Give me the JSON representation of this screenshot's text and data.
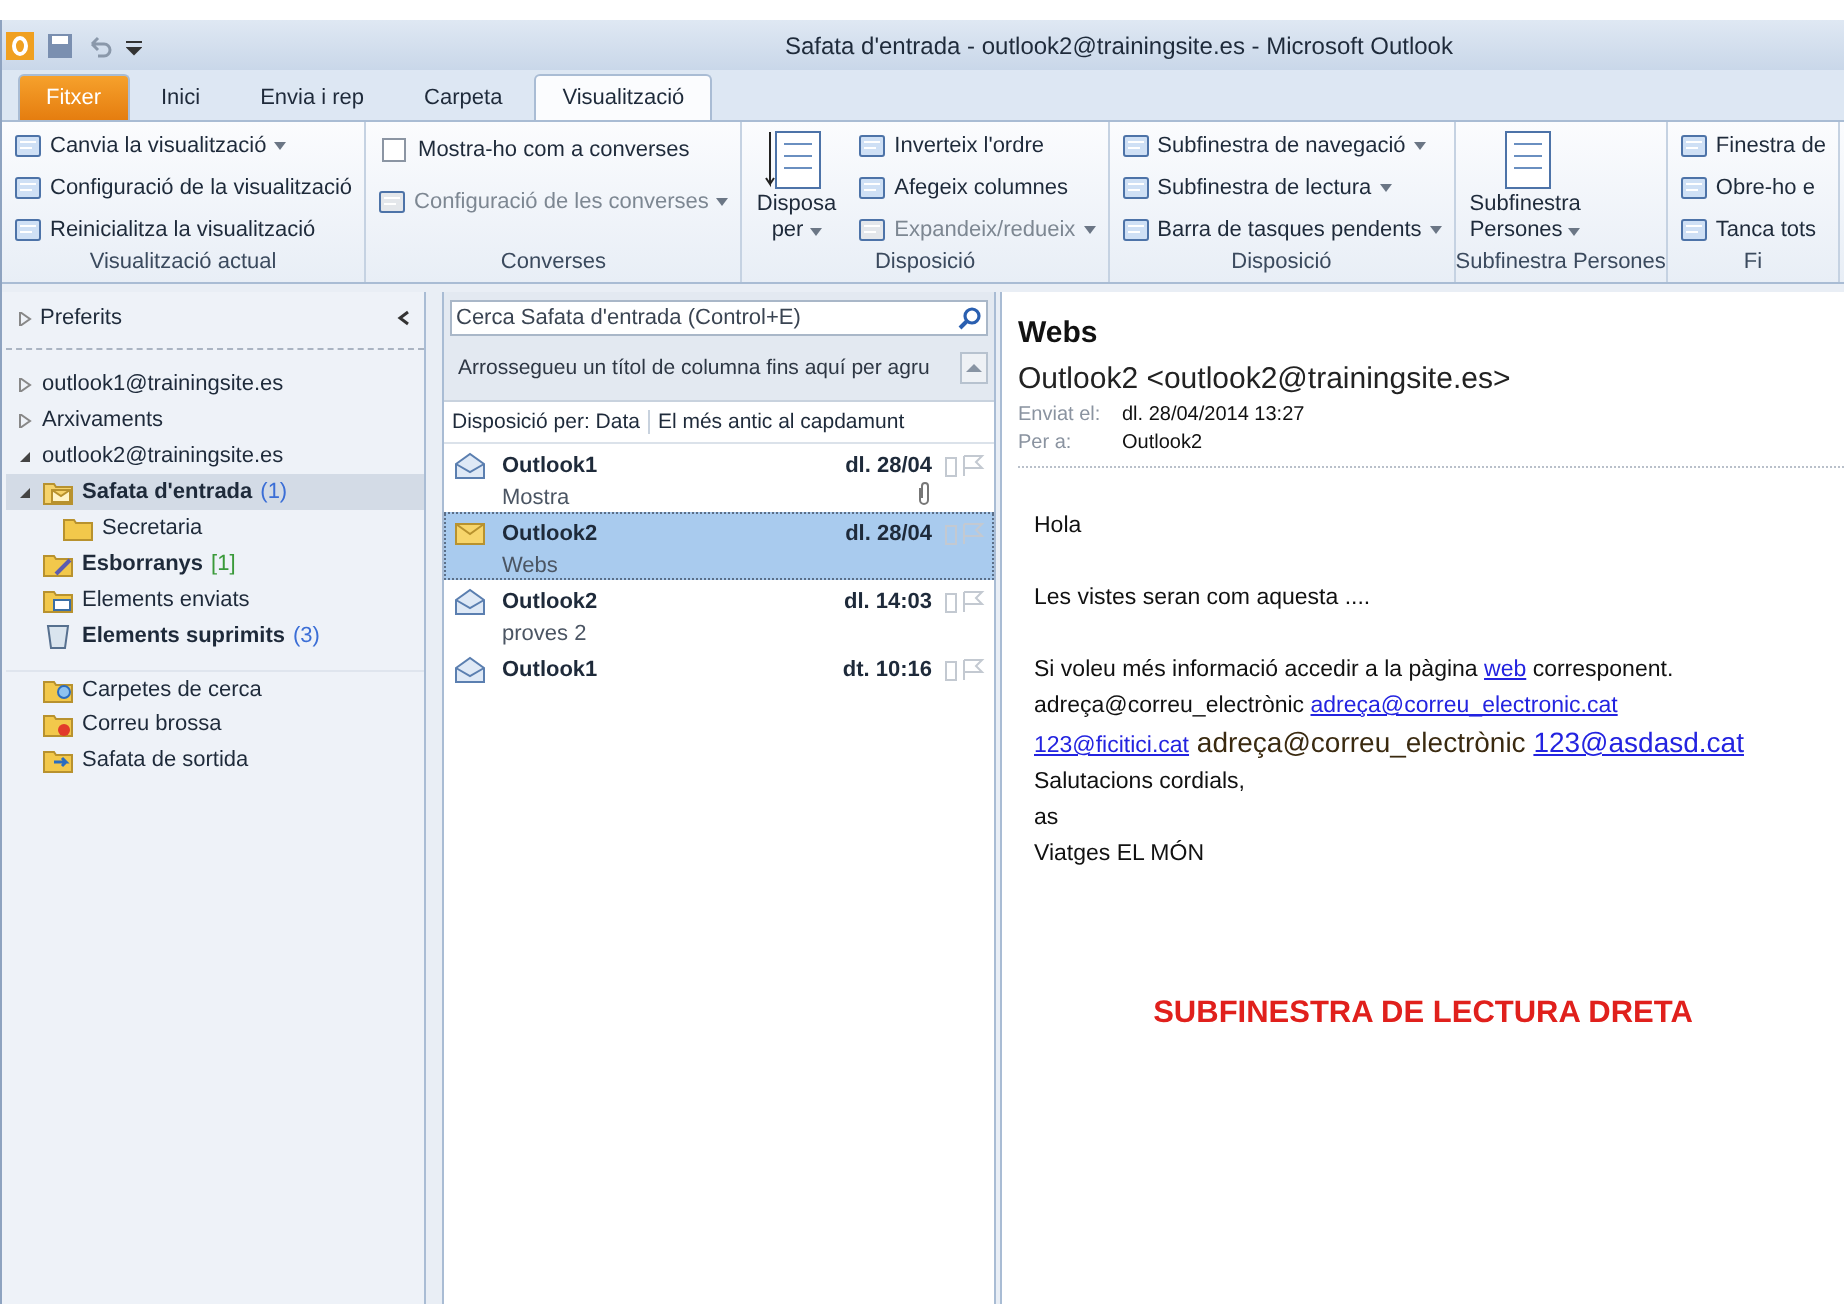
{
  "window": {
    "title": "Safata d'entrada - outlook2@trainingsite.es  -  Microsoft Outlook"
  },
  "tabs": [
    {
      "label": "Fitxer",
      "kind": "file",
      "selected": false
    },
    {
      "label": "Inici",
      "kind": "tab",
      "selected": false
    },
    {
      "label": "Envia i rep",
      "kind": "tab",
      "selected": false
    },
    {
      "label": "Carpeta",
      "kind": "tab",
      "selected": false
    },
    {
      "label": "Visualització",
      "kind": "tab",
      "selected": true
    }
  ],
  "ribbon": [
    {
      "label": "Visualització actual",
      "items": [
        {
          "label": "Canvia la visualització",
          "kind": "small",
          "dropdown": true,
          "disabled": false
        },
        {
          "label": "Configuració de la visualització",
          "kind": "small",
          "dropdown": false,
          "disabled": false
        },
        {
          "label": "Reinicialitza la visualització",
          "kind": "small",
          "dropdown": false,
          "disabled": false
        }
      ]
    },
    {
      "label": "Converses",
      "items": [
        {
          "label": "Mostra-ho com a converses",
          "kind": "checkbox",
          "checked": false
        },
        {
          "label": "Configuració de les converses",
          "kind": "small",
          "dropdown": true,
          "disabled": true
        }
      ]
    },
    {
      "label": "Disposició",
      "items": [
        {
          "label": "Disposa",
          "label2": "per",
          "kind": "large",
          "dropdown": true
        },
        {
          "label": "Inverteix l'ordre",
          "kind": "small",
          "dropdown": false,
          "disabled": false
        },
        {
          "label": "Afegeix columnes",
          "kind": "small",
          "dropdown": false,
          "disabled": false
        },
        {
          "label": "Expandeix/redueix",
          "kind": "small",
          "dropdown": true,
          "disabled": true
        }
      ]
    },
    {
      "label": "Disposició",
      "items": [
        {
          "label": "Subfinestra de navegació",
          "kind": "small",
          "dropdown": true,
          "disabled": false
        },
        {
          "label": "Subfinestra de lectura",
          "kind": "small",
          "dropdown": true,
          "disabled": false
        },
        {
          "label": "Barra de tasques pendents",
          "kind": "small",
          "dropdown": true,
          "disabled": false
        }
      ]
    },
    {
      "label": "Subfinestra Persones",
      "items": [
        {
          "label": "Subfinestra",
          "label2": "Persones",
          "kind": "large",
          "dropdown": true
        }
      ]
    },
    {
      "label": "Fi",
      "items": [
        {
          "label": "Finestra de",
          "kind": "small",
          "dropdown": false,
          "disabled": false
        },
        {
          "label": "Obre-ho e",
          "kind": "small",
          "dropdown": false,
          "disabled": false
        },
        {
          "label": "Tanca tots",
          "kind": "small",
          "dropdown": false,
          "disabled": false
        }
      ]
    }
  ],
  "navigation": {
    "favorites": {
      "label": "Preferits",
      "expanded": false
    },
    "tree": [
      {
        "label": "outlook1@trainingsite.es",
        "kind": "account",
        "expanded": false,
        "selected": false,
        "unread": false
      },
      {
        "label": "Arxivaments",
        "kind": "account",
        "expanded": false,
        "selected": false,
        "unread": false
      },
      {
        "label": "outlook2@trainingsite.es",
        "kind": "account",
        "expanded": true,
        "selected": false,
        "unread": false,
        "children": [
          {
            "label": "Safata d'entrada",
            "kind": "inbox",
            "count": "(1)",
            "color": "#3b6ed6",
            "expanded": true,
            "selected": true,
            "unread": true,
            "children": [
              {
                "label": "Secretaria",
                "kind": "folder",
                "selected": false,
                "unread": false
              }
            ]
          },
          {
            "label": "Esborranys",
            "kind": "drafts",
            "count": "[1]",
            "color": "#3a9a3a",
            "selected": false,
            "unread": true
          },
          {
            "label": "Elements enviats",
            "kind": "sent",
            "selected": false,
            "unread": false
          },
          {
            "label": "Elements suprimits",
            "kind": "deleted",
            "count": "(3)",
            "color": "#3b6ed6",
            "selected": false,
            "unread": true
          },
          {
            "label": "Carpetes de cerca",
            "kind": "search",
            "selected": false,
            "unread": false,
            "gap_before": true
          },
          {
            "label": "Correu brossa",
            "kind": "junk",
            "selected": false,
            "unread": false
          },
          {
            "label": "Safata de sortida",
            "kind": "outbox",
            "selected": false,
            "unread": false
          }
        ]
      }
    ]
  },
  "message_list": {
    "search": {
      "placeholder": "Cerca Safata d'entrada (Control+E)"
    },
    "group_hint": "Arrossegueu un títol de columna fins aquí per agru",
    "arrange_by": "Disposició per: Data",
    "sort_order": "El més antic al capdamunt",
    "messages": [
      {
        "sender": "Outlook1",
        "subject": "Mostra",
        "date": "dl. 28/04",
        "attachment": true,
        "read": true,
        "selected": false
      },
      {
        "sender": "Outlook2",
        "subject": "Webs",
        "date": "dl. 28/04",
        "attachment": false,
        "read": false,
        "selected": true
      },
      {
        "sender": "Outlook2",
        "subject": "proves 2",
        "date": "dl. 14:03",
        "attachment": false,
        "read": true,
        "selected": false
      },
      {
        "sender": "Outlook1",
        "date": "dt. 10:16",
        "attachment": false,
        "read": true,
        "selected": false
      }
    ]
  },
  "reading_pane": {
    "subject": "Webs",
    "from": "Outlook2 <outlook2@trainingsite.es>",
    "sent_label": "Enviat el:",
    "sent": "dl. 28/04/2014 13:27",
    "to_label": "Per a:",
    "to": "Outlook2",
    "body": [
      {
        "segments": [
          {
            "kind": "text",
            "text": "Hola"
          }
        ]
      },
      {
        "gap_before": true,
        "segments": [
          {
            "kind": "text",
            "text": "Les vistes seran com aquesta ...."
          }
        ]
      },
      {
        "gap_before": true,
        "segments": [
          {
            "kind": "text",
            "text": "Si voleu més informació accedir a la pàgina "
          },
          {
            "kind": "link",
            "text": "web"
          },
          {
            "kind": "text",
            "text": " corresponent."
          }
        ]
      },
      {
        "segments": [
          {
            "kind": "text",
            "text": "adreça@correu_electrònic "
          },
          {
            "kind": "link",
            "text": "adreça@correu_electronic.cat"
          }
        ]
      },
      {
        "segments": [
          {
            "kind": "link",
            "text": "123@ficitici.cat"
          },
          {
            "kind": "large-text",
            "text": " adreça@correu_electrònic "
          },
          {
            "kind": "large-link",
            "text": "123@asdasd.cat"
          }
        ]
      },
      {
        "segments": [
          {
            "kind": "text",
            "text": "Salutacions cordials,"
          }
        ]
      },
      {
        "segments": [
          {
            "kind": "text",
            "text": "as"
          }
        ]
      },
      {
        "segments": [
          {
            "kind": "text",
            "text": "Viatges EL MÓN"
          }
        ]
      }
    ],
    "annotation": "SUBFINESTRA DE LECTURA DRETA"
  }
}
